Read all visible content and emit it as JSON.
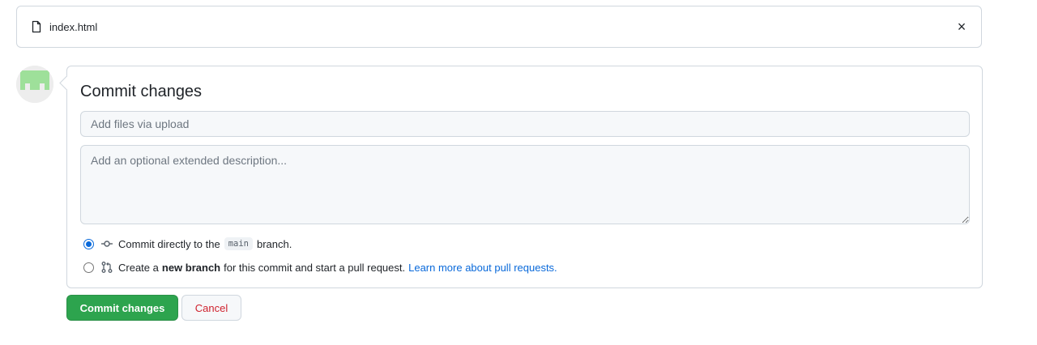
{
  "file": {
    "name": "index.html",
    "icon": "file-icon",
    "close_label": "×"
  },
  "avatar": {
    "icon": "identicon-avatar",
    "color": "#9ee09a"
  },
  "commit": {
    "title": "Commit changes",
    "summary_placeholder": "Add files via upload",
    "description_placeholder": "Add an optional extended description...",
    "options": [
      {
        "checked": true,
        "icon": "git-commit-icon",
        "text_before": "Commit directly to the",
        "branch": "main",
        "text_after": "branch."
      },
      {
        "checked": false,
        "icon": "git-pull-request-icon",
        "text_before": "Create a",
        "bold": "new branch",
        "text_after": "for this commit and start a pull request.",
        "link": "Learn more about pull requests."
      }
    ]
  },
  "actions": {
    "commit_label": "Commit changes",
    "cancel_label": "Cancel"
  },
  "colors": {
    "primary": "#2da44e",
    "link": "#0969da",
    "danger": "#cf222e",
    "border": "#d0d7de"
  }
}
